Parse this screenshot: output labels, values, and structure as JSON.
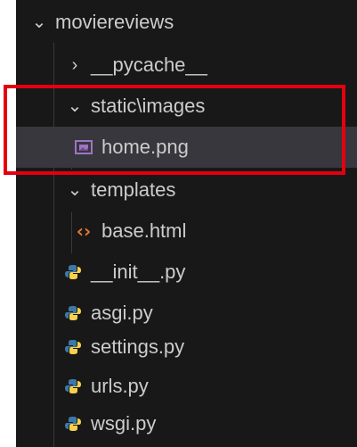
{
  "tree": {
    "root": {
      "label": "moviereviews",
      "expanded": true
    },
    "items": [
      {
        "label": "__pycache__",
        "type": "folder",
        "expanded": false,
        "depth": 1
      },
      {
        "label": "static\\images",
        "type": "folder",
        "expanded": true,
        "depth": 1,
        "path_parts": [
          "static",
          "images"
        ]
      },
      {
        "label": "home.png",
        "type": "image",
        "depth": 2,
        "selected": true
      },
      {
        "label": "templates",
        "type": "folder",
        "expanded": true,
        "depth": 1
      },
      {
        "label": "base.html",
        "type": "html",
        "depth": 2
      },
      {
        "label": "__init__.py",
        "type": "python",
        "depth": 1
      },
      {
        "label": "asgi.py",
        "type": "python",
        "depth": 1
      },
      {
        "label": "settings.py",
        "type": "python",
        "depth": 1
      },
      {
        "label": "urls.py",
        "type": "python",
        "depth": 1
      },
      {
        "label": "wsgi.py",
        "type": "python",
        "depth": 1
      }
    ]
  },
  "colors": {
    "background": "#181818",
    "selected_row": "#37373d",
    "text": "#cccccc",
    "highlight_border": "#e3000f",
    "python_icon_blue": "#3c78aa",
    "python_icon_yellow": "#f7d14c",
    "html_icon": "#e37933",
    "image_icon": "#a074c4"
  },
  "icons": {
    "collapsed": "chevron-right-icon",
    "expanded": "chevron-down-icon",
    "python": "python-file-icon",
    "html": "html-file-icon",
    "image": "image-file-icon"
  }
}
